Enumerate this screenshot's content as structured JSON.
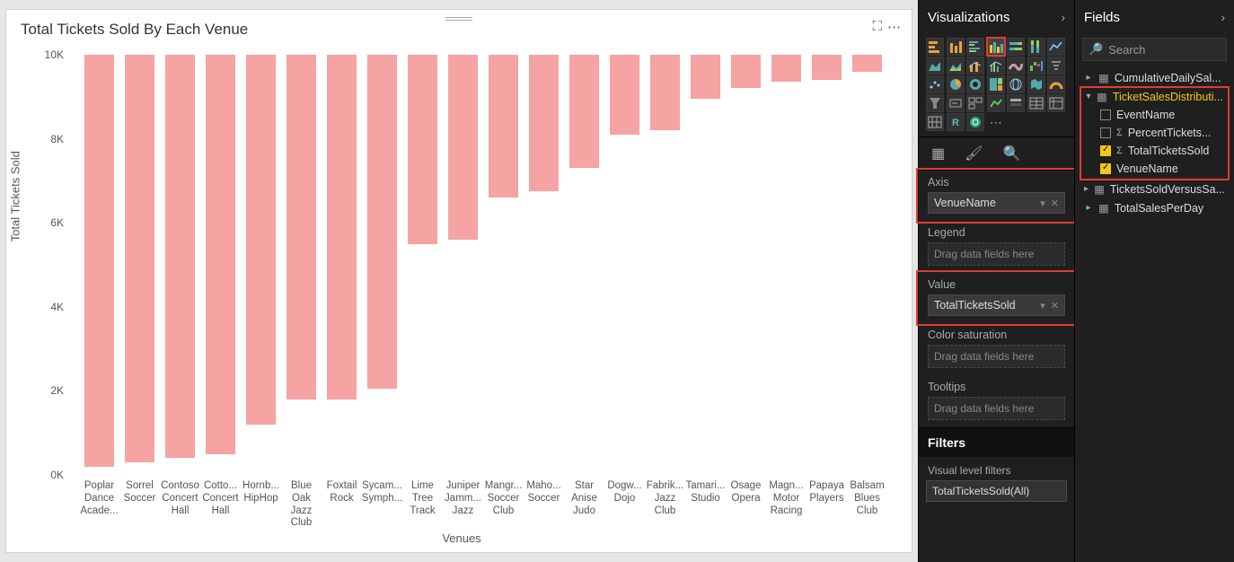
{
  "chart": {
    "title": "Total Tickets Sold By Each Venue",
    "ylabel": "Total Tickets Sold",
    "xlabel": "Venues"
  },
  "chart_data": {
    "type": "bar",
    "title": "Total Tickets Sold By Each Venue",
    "xlabel": "Venues",
    "ylabel": "Total Tickets Sold",
    "ylim": [
      0,
      10000
    ],
    "yticks": [
      0,
      2000,
      4000,
      6000,
      8000,
      10000
    ],
    "ytick_labels": [
      "0K",
      "2K",
      "4K",
      "6K",
      "8K",
      "10K"
    ],
    "categories": [
      "Poplar Dance Acade...",
      "Sorrel Soccer",
      "Contoso Concert Hall",
      "Cotto... Concert Hall",
      "Hornb... HipHop",
      "Blue Oak Jazz Club",
      "Foxtail Rock",
      "Sycam... Symph...",
      "Lime Tree Track",
      "Juniper Jamm... Jazz",
      "Mangr... Soccer Club",
      "Maho... Soccer",
      "Star Anise Judo",
      "Dogw... Dojo",
      "Fabrik... Jazz Club",
      "Tamari... Studio",
      "Osage Opera",
      "Magn... Motor Racing",
      "Papaya Players",
      "Balsam Blues Club"
    ],
    "values": [
      9800,
      9700,
      9600,
      9500,
      8800,
      8200,
      8200,
      7950,
      4500,
      4400,
      3400,
      3250,
      2700,
      1900,
      1800,
      1050,
      800,
      650,
      600,
      400
    ]
  },
  "ytick_l": {
    "0": "0K",
    "1": "2K",
    "2": "4K",
    "3": "6K",
    "4": "8K",
    "5": "10K"
  },
  "viz_panel": {
    "title": "Visualizations",
    "axis_label": "Axis",
    "axis_value": "VenueName",
    "legend_label": "Legend",
    "legend_placeholder": "Drag data fields here",
    "value_label": "Value",
    "value_value": "TotalTicketsSold",
    "colorsat_label": "Color saturation",
    "colorsat_placeholder": "Drag data fields here",
    "tooltips_label": "Tooltips",
    "tooltips_placeholder": "Drag data fields here",
    "filters_title": "Filters",
    "filters_sub": "Visual level filters",
    "filter_pill": "TotalTicketsSold(All)"
  },
  "fields_panel": {
    "title": "Fields",
    "search_placeholder": "Search",
    "tables": {
      "t0": "CumulativeDailySal...",
      "t1": "TicketSalesDistributi...",
      "t1_fields": {
        "f0": "EventName",
        "f1": "PercentTickets...",
        "f2": "TotalTicketsSold",
        "f3": "VenueName"
      },
      "t2": "TicketsSoldVersusSa...",
      "t3": "TotalSalesPerDay"
    }
  }
}
